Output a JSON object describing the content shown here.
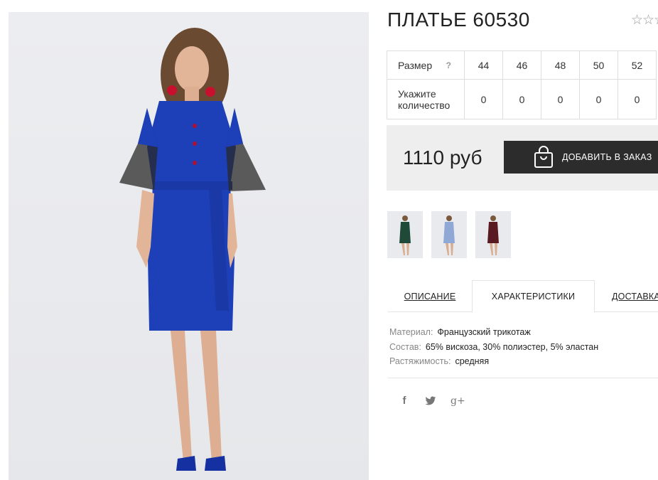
{
  "product": {
    "title": "ПЛАТЬЕ 60530",
    "rating_icons": "☆☆☆",
    "price": "1110 руб",
    "add_to_order_label": "ДОБАВИТЬ В ЗАКАЗ"
  },
  "size_table": {
    "size_label": "Размер",
    "help_icon": "?",
    "qty_label": "Укажите количество",
    "sizes": [
      "44",
      "46",
      "48",
      "50",
      "52"
    ],
    "quantities": [
      "0",
      "0",
      "0",
      "0",
      "0"
    ]
  },
  "thumbnails": [
    {
      "color": "#1f4a3a",
      "name": "green"
    },
    {
      "color": "#8fa8d6",
      "name": "light-blue"
    },
    {
      "color": "#5a1a22",
      "name": "burgundy"
    }
  ],
  "tabs": [
    {
      "label": "ОПИСАНИЕ"
    },
    {
      "label": "ХАРАКТЕРИСТИКИ"
    },
    {
      "label": "ДОСТАВКА"
    }
  ],
  "specs": [
    {
      "key": "Материал:",
      "value": "Французский трикотаж"
    },
    {
      "key": "Состав:",
      "value": "65% вискоза, 30% полиэстер, 5% эластан"
    },
    {
      "key": "Растяжимость:",
      "value": "средняя"
    }
  ],
  "social": {
    "facebook": "f",
    "twitter": "🐦",
    "googleplus": "g+"
  },
  "colors": {
    "dress": "#1d3fb8",
    "button_bg": "#2c2c2c",
    "price_bar_bg": "#eeeeee"
  }
}
